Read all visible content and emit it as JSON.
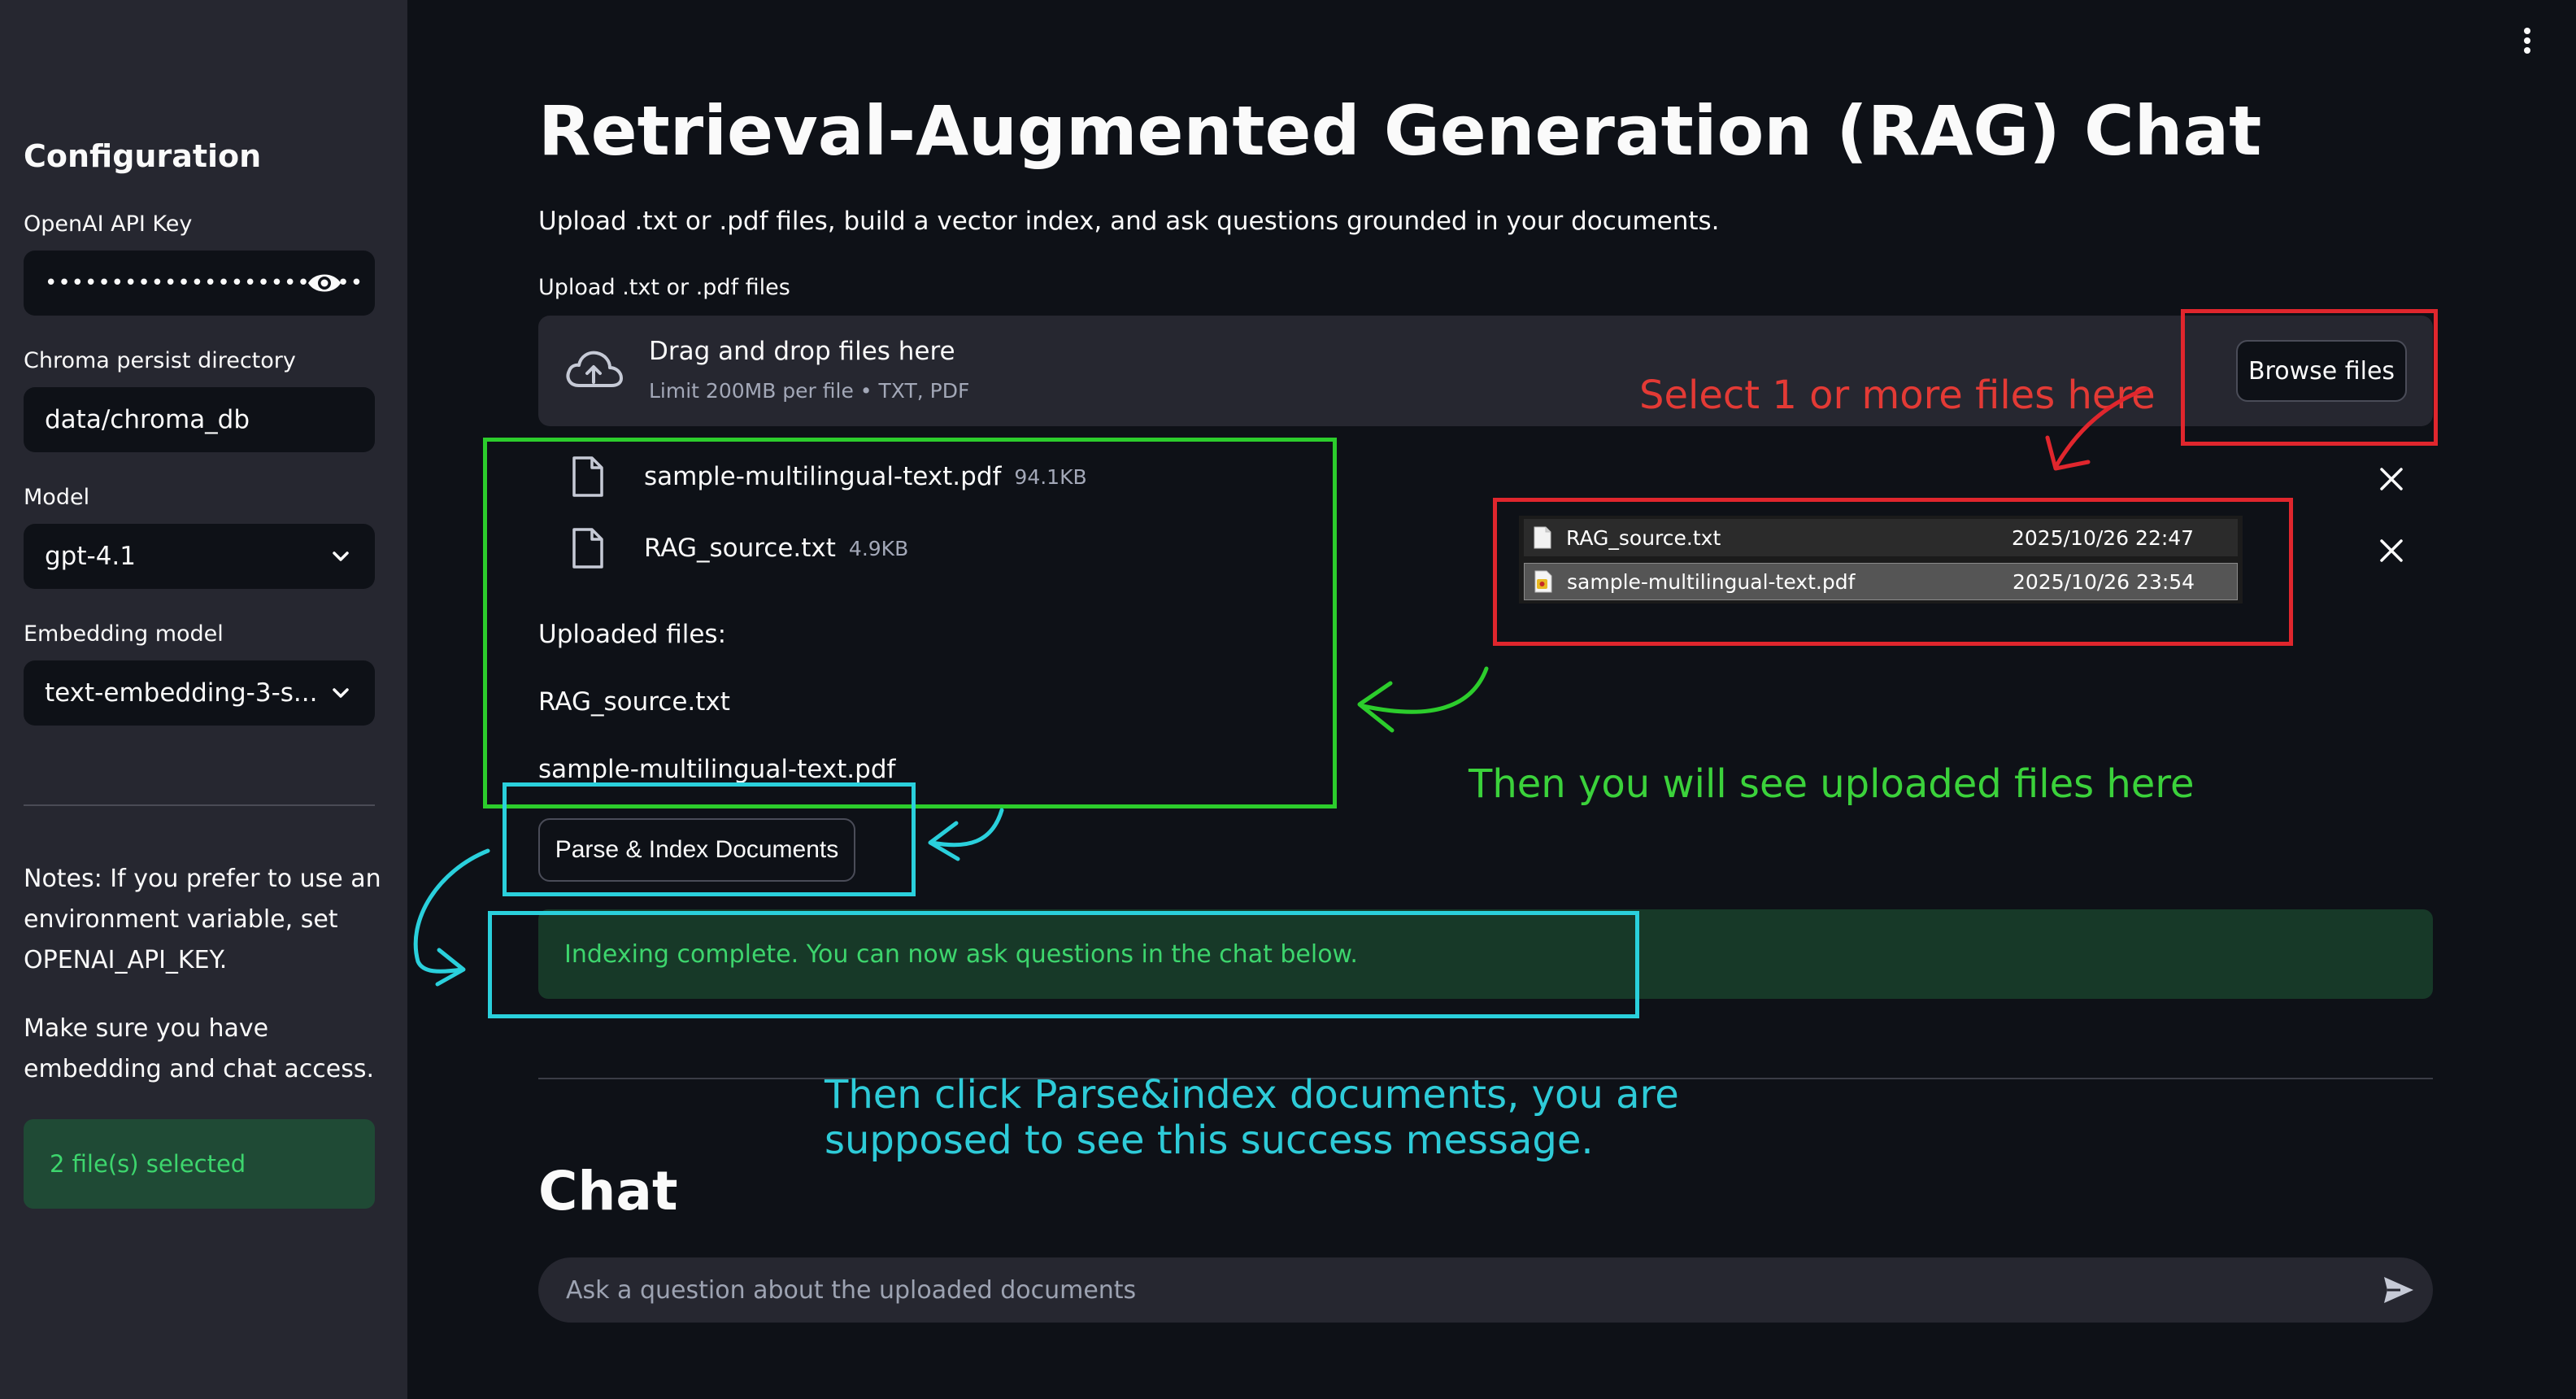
{
  "sidebar": {
    "heading": "Configuration",
    "api_key": {
      "label": "OpenAI API Key",
      "value": "••••••••••••••••••••••••"
    },
    "persist_dir": {
      "label": "Chroma persist directory",
      "value": "data/chroma_db"
    },
    "model": {
      "label": "Model",
      "selected": "gpt-4.1"
    },
    "embedding": {
      "label": "Embedding model",
      "selected": "text-embedding-3-s..."
    },
    "notes": [
      "Notes: If you prefer to use an environment variable, set OPENAI_API_KEY.",
      "Make sure you have embedding and chat access."
    ],
    "status": "2 file(s) selected"
  },
  "main": {
    "title": "Retrieval-Augmented Generation (RAG) Chat",
    "subtitle": "Upload .txt or .pdf files, build a vector index, and ask questions grounded in your documents.",
    "uploader": {
      "label": "Upload .txt or .pdf files",
      "drop_title": "Drag and drop files here",
      "drop_sub": "Limit 200MB per file • TXT, PDF",
      "browse_label": "Browse files",
      "files": [
        {
          "name": "sample-multilingual-text.pdf",
          "size": "94.1KB"
        },
        {
          "name": "RAG_source.txt",
          "size": "4.9KB"
        }
      ]
    },
    "uploaded": {
      "heading": "Uploaded files:",
      "items": [
        "RAG_source.txt",
        "sample-multilingual-text.pdf"
      ]
    },
    "parse_button": "Parse & Index Documents",
    "success_message": "Indexing complete. You can now ask questions in the chat below.",
    "chat": {
      "heading": "Chat",
      "placeholder": "Ask a question about the uploaded documents"
    }
  },
  "file_dialog": {
    "rows": [
      {
        "name": "RAG_source.txt",
        "date": "2025/10/26 22:47"
      },
      {
        "name": "sample-multilingual-text.pdf",
        "date": "2025/10/26 23:54"
      }
    ]
  },
  "annotations": {
    "select_files": "Select 1 or more files here",
    "see_uploaded": "Then you will see uploaded files here",
    "click_parse_line1": "Then click Parse&index documents, you are",
    "click_parse_line2": "supposed to see this success message."
  },
  "colors": {
    "background": "#0e1117",
    "sidebar": "#262730",
    "success_text": "#3dd56d",
    "annotation_red": "#e0262d",
    "annotation_green": "#2ccd2c",
    "annotation_cyan": "#2ad0dc"
  },
  "icons": {
    "password_toggle": "eye-icon",
    "select_caret": "chevron-down-icon",
    "upload": "cloud-upload-icon",
    "file": "file-icon",
    "remove": "close-icon",
    "send": "send-icon",
    "menu": "more-vertical-icon"
  }
}
